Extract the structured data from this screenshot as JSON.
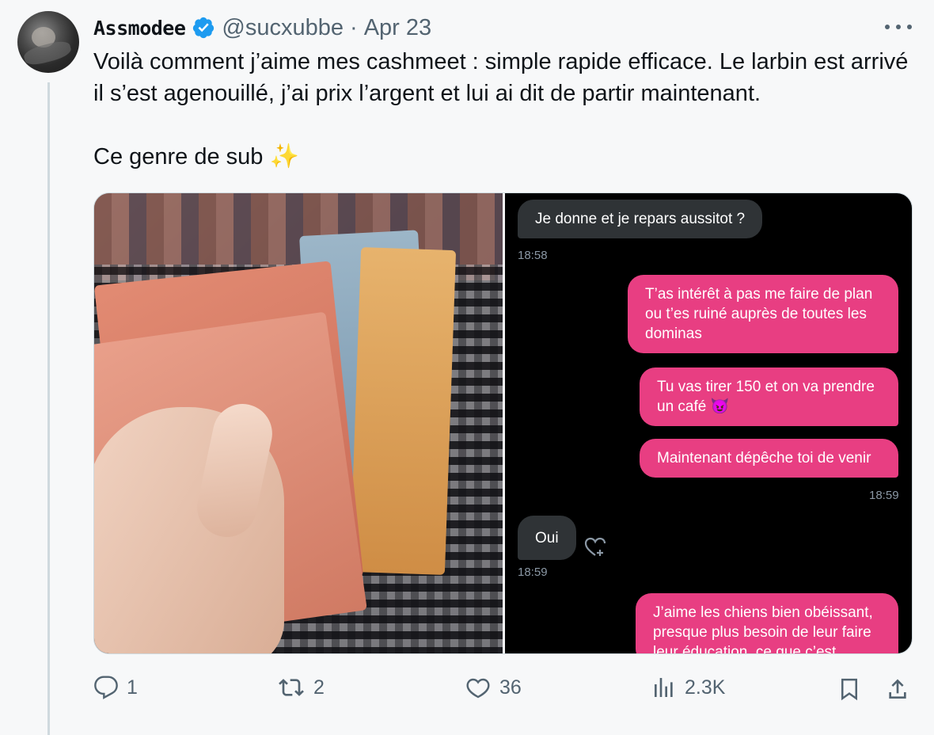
{
  "tweet": {
    "author": {
      "display_name": "Assmodee",
      "handle": "@sucxubbe",
      "separator": "·",
      "date": "Apr 23"
    },
    "text_line1": "Voilà comment j’aime mes cashmeet : simple rapide efficace. Le larbin est arrivé il s’est agenouillé, j’ai prix l’argent et lui ai dit de partir maintenant.",
    "text_line2": "Ce genre de sub",
    "emoji": "✨"
  },
  "chat": {
    "messages": [
      {
        "dir": "in",
        "text": "Je donne et je repars aussitot ?"
      },
      {
        "dir": "time",
        "text": "18:58"
      },
      {
        "dir": "out",
        "text": "T’as intérêt à pas me faire de plan ou t’es ruiné auprès de toutes les dominas"
      },
      {
        "dir": "out",
        "text": "Tu vas tirer 150 et on va prendre un café 😈"
      },
      {
        "dir": "out",
        "text": "Maintenant dépêche toi de venir"
      },
      {
        "dir": "time",
        "text": "18:59"
      },
      {
        "dir": "in",
        "text": "Oui"
      },
      {
        "dir": "time",
        "text": "18:59"
      },
      {
        "dir": "out",
        "text": "J’aime les chiens bien obéissant, presque plus besoin de leur faire leur éducation, ce que c’est"
      }
    ]
  },
  "actions": {
    "replies": "1",
    "reposts": "2",
    "likes": "36",
    "views": "2.3K"
  },
  "colors": {
    "accent_verified": "#1d9bf0",
    "message_out": "#e83e82",
    "message_in": "#2f3336",
    "secondary_text": "#536471"
  }
}
